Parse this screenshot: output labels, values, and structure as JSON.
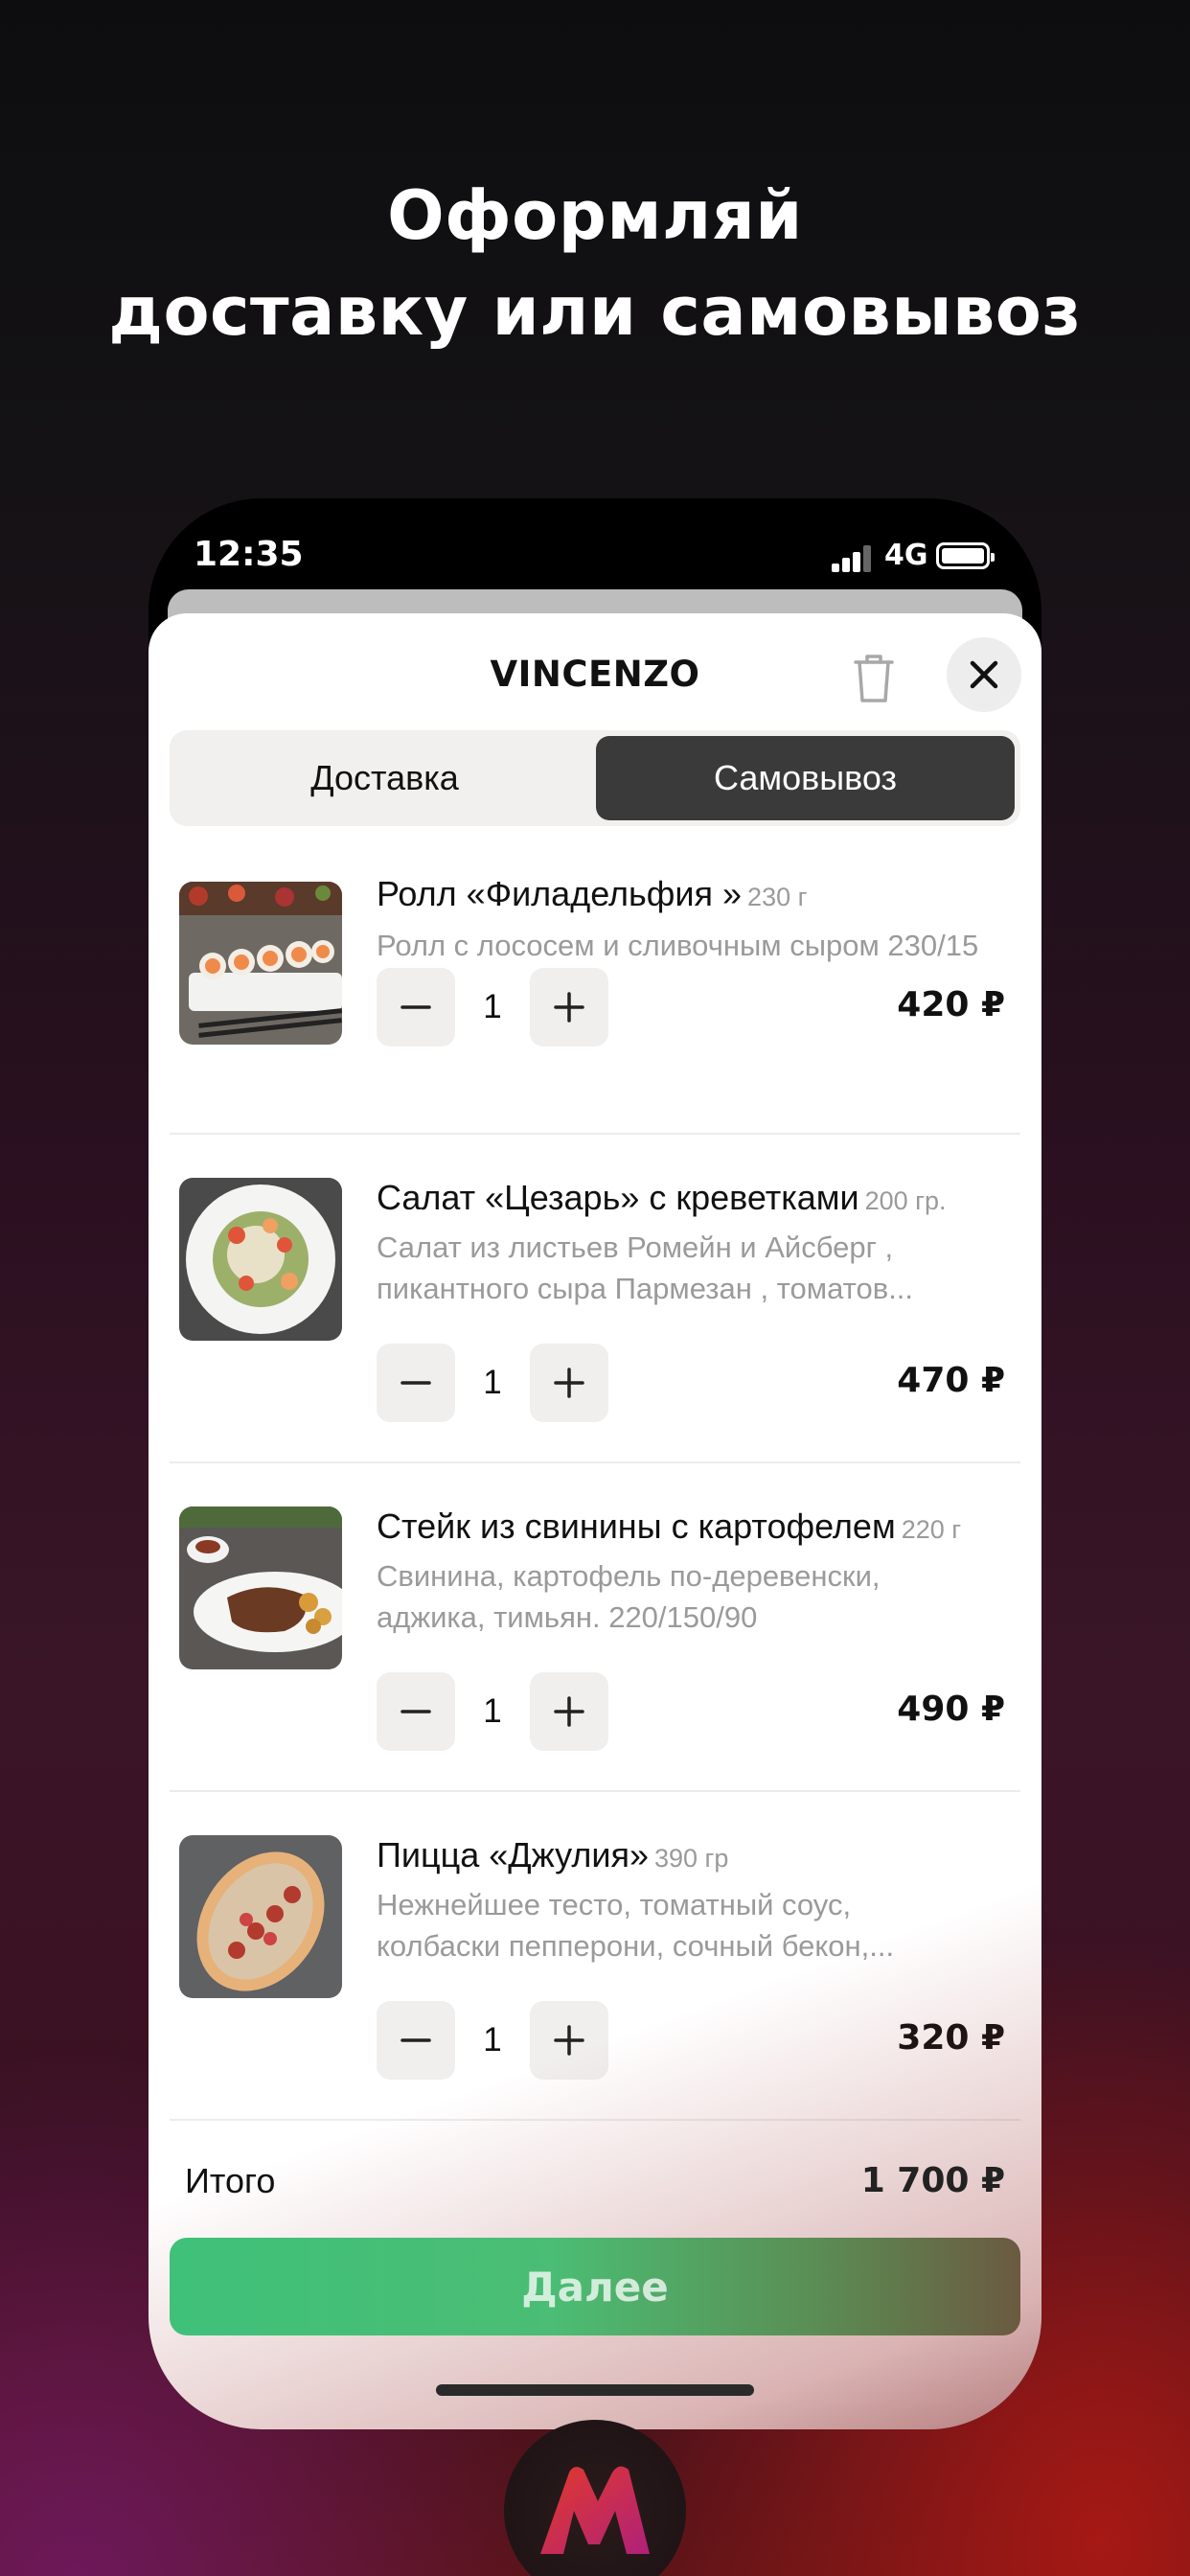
{
  "headline": {
    "line1": "Оформляй",
    "line2": "доставку или самовывоз"
  },
  "statusbar": {
    "time": "12:35",
    "network": "4G"
  },
  "sheet": {
    "title": "VINCENZO",
    "tabs": [
      {
        "label": "Доставка",
        "active": false
      },
      {
        "label": "Самовывоз",
        "active": true
      }
    ]
  },
  "items": [
    {
      "name": "Ролл «Филадельфия »",
      "weight": "230 г",
      "desc1": "Ролл с лососем и сливочным сыром 230/15",
      "desc2": "",
      "qty": "1",
      "price": "420 ₽"
    },
    {
      "name": "Салат «Цезарь» с креветками",
      "weight": "200 гр.",
      "desc1": "Салат из листьев Ромейн и Айсберг ,",
      "desc2": "пикантного сыра Пармезан , томатов...",
      "qty": "1",
      "price": "470 ₽"
    },
    {
      "name": "Стейк из свинины с картофелем",
      "weight": "220 г",
      "desc1": "Свинина, картофель по-деревенски,",
      "desc2": "аджика, тимьян. 220/150/90",
      "qty": "1",
      "price": "490 ₽"
    },
    {
      "name": "Пицца «Джулия»",
      "weight": "390 гр",
      "desc1": "Нежнейшее тесто, томатный соус,",
      "desc2": "колбаски пепперони, сочный бекон,...",
      "qty": "1",
      "price": "320 ₽"
    }
  ],
  "total": {
    "label": "Итого",
    "value": "1 700 ₽"
  },
  "next_button": "Далее",
  "colors": {
    "accent": "#3fc17a",
    "segment_active": "#3a3a3a"
  }
}
